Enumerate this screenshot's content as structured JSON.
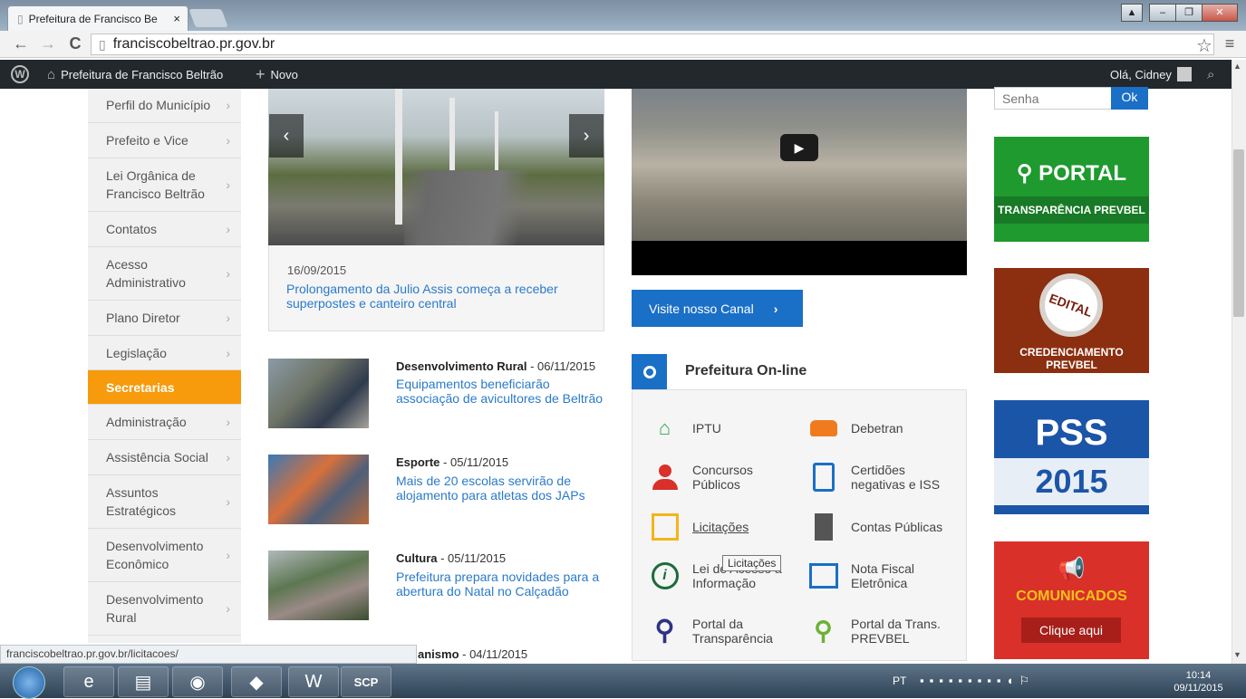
{
  "browser": {
    "tab_title": "Prefeitura de Francisco Be",
    "tab_close": "×",
    "url": "franciscobeltrao.pr.gov.br",
    "win_buttons": [
      "▲",
      "–",
      "❐",
      "✕"
    ]
  },
  "wpbar": {
    "site": "Prefeitura de Francisco Beltrão",
    "new": "Novo",
    "greeting": "Olá, Cidney"
  },
  "sidebar": {
    "items": [
      {
        "label": "Perfil do Município"
      },
      {
        "label": "Prefeito e Vice"
      },
      {
        "label": "Lei Orgânica de Francisco Beltrão"
      },
      {
        "label": "Contatos"
      },
      {
        "label": "Acesso Administrativo"
      },
      {
        "label": "Plano Diretor"
      },
      {
        "label": "Legislação"
      },
      {
        "label": "Secretarias"
      },
      {
        "label": "Administração"
      },
      {
        "label": "Assistência Social"
      },
      {
        "label": "Assuntos Estratégicos"
      },
      {
        "label": "Desenvolvimento Econômico"
      },
      {
        "label": "Desenvolvimento Rural"
      }
    ]
  },
  "slide": {
    "date": "16/09/2015",
    "title": "Prolongamento da Julio Assis começa a receber superpostes e canteiro central"
  },
  "news": [
    {
      "category": "Desenvolvimento Rural",
      "date": " - 06/11/2015",
      "title": "Equipamentos beneficiarão associação de avicultores de Beltrão"
    },
    {
      "category": "Esporte",
      "date": " - 05/11/2015",
      "title": "Mais de 20 escolas servirão de alojamento para atletas dos JAPs"
    },
    {
      "category": "Cultura",
      "date": " - 05/11/2015",
      "title": "Prefeitura prepara novidades para a abertura do Natal no Calçadão"
    },
    {
      "category": "anismo",
      "date": " - 04/11/2015",
      "title": ""
    }
  ],
  "video": {
    "button": "Visite nosso Canal"
  },
  "online": {
    "title": "Prefeitura On-line",
    "items": [
      {
        "label": "IPTU",
        "icon": "house-icon",
        "color": "#2ea84a"
      },
      {
        "label": "Debetran",
        "icon": "car-icon",
        "color": "#f07b1f"
      },
      {
        "label": "Concursos Públicos",
        "icon": "person-icon",
        "color": "#d9302a"
      },
      {
        "label": "Certidões negativas e ISS",
        "icon": "document-icon",
        "color": "#1a6fc7"
      },
      {
        "label": "Licitações",
        "icon": "list-icon",
        "color": "#f3b51a"
      },
      {
        "label": "Contas Públicas",
        "icon": "calculator-icon",
        "color": "#555555"
      },
      {
        "label": "Lei de Acesso à Informação",
        "icon": "info-icon",
        "color": "#1c6b3b"
      },
      {
        "label": "Nota Fiscal Eletrônica",
        "icon": "invoice-icon",
        "color": "#1a6fc7"
      },
      {
        "label": "Portal da Transparência",
        "icon": "magnifier-icon",
        "color": "#2d3480"
      },
      {
        "label": "Portal da Trans. PREVBEL",
        "icon": "pin-search-icon",
        "color": "#6bb233"
      }
    ],
    "tooltip": "Licitações"
  },
  "login": {
    "password_placeholder": "Senha",
    "ok": "Ok"
  },
  "banners": {
    "portal_top": "PORTAL",
    "portal_bottom": "TRANSPARÊNCIA PREVBEL",
    "edital_seal": "EDITAL",
    "edital_bottom": "CREDENCIAMENTO PREVBEL",
    "pss_top": "PSS",
    "pss_bottom": "2015",
    "com_title": "COMUNICADOS",
    "com_button": "Clique aqui"
  },
  "status_url": "franciscobeltrao.pr.gov.br/licitacoes/",
  "taskbar": {
    "lang": "PT",
    "time": "10:14",
    "date": "09/11/2015",
    "scp": "SCP"
  },
  "colors": {
    "accent": "#f79a0b",
    "blue": "#1a6fc7",
    "link": "#2a7ac9",
    "wpbar": "#23282d"
  }
}
